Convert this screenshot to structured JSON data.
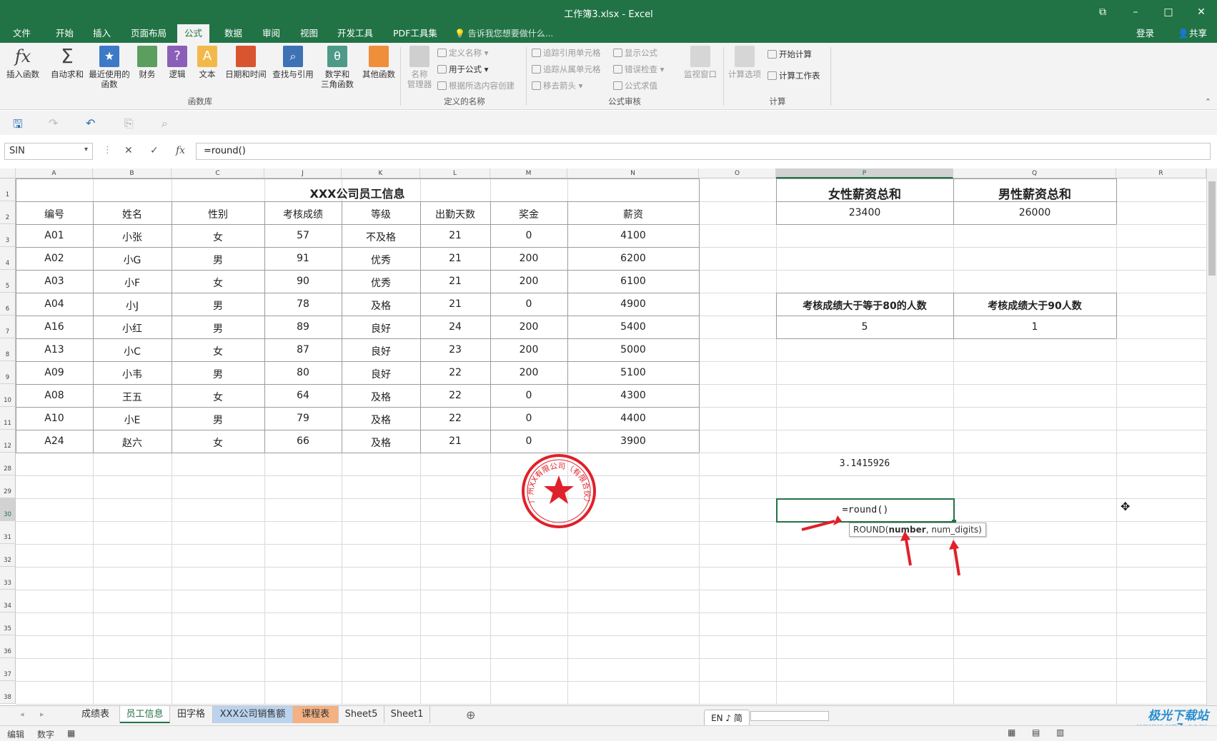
{
  "window": {
    "title": "工作簿3.xlsx - Excel"
  },
  "ribbon_tabs": [
    "文件",
    "开始",
    "插入",
    "页面布局",
    "公式",
    "数据",
    "审阅",
    "视图",
    "开发工具",
    "PDF工具集"
  ],
  "active_tab": "公式",
  "tell_me": "告诉我您想要做什么...",
  "account": {
    "login": "登录",
    "share": "共享"
  },
  "ribbon": {
    "insert_function": "插入函数",
    "autosum": "自动求和",
    "recent_line1": "最近使用的",
    "recent_line2": "函数",
    "financial": "财务",
    "logical": "逻辑",
    "text": "文本",
    "datetime": "日期和时间",
    "lookup": "查找与引用",
    "math_line1": "数学和",
    "math_line2": "三角函数",
    "other": "其他函数",
    "group_library": "函数库",
    "name_manager_line1": "名称",
    "name_manager_line2": "管理器",
    "define_name": "定义名称",
    "use_in_formula": "用于公式",
    "create_from_selection": "根据所选内容创建",
    "group_names": "定义的名称",
    "trace_precedents": "追踪引用单元格",
    "trace_dependents": "追踪从属单元格",
    "remove_arrows": "移去箭头",
    "show_formulas": "显示公式",
    "error_checking": "错误检查",
    "evaluate_formula": "公式求值",
    "watch_window": "监视窗口",
    "group_auditing": "公式审核",
    "calc_options": "计算选项",
    "calc_now": "开始计算",
    "calc_sheet": "计算工作表",
    "group_calc": "计算"
  },
  "formula_bar": {
    "name_box": "SIN",
    "formula": "=round()"
  },
  "columns": [
    "A",
    "B",
    "C",
    "J",
    "K",
    "L",
    "M",
    "N",
    "O",
    "P",
    "Q",
    "R"
  ],
  "rows": [
    "1",
    "2",
    "3",
    "4",
    "5",
    "6",
    "7",
    "8",
    "9",
    "10",
    "11",
    "12",
    "28",
    "29",
    "30",
    "31",
    "32",
    "33",
    "34",
    "35",
    "36",
    "37",
    "38"
  ],
  "table": {
    "title": "XXX公司员工信息",
    "headers": [
      "编号",
      "姓名",
      "性别",
      "考核成绩",
      "等级",
      "出勤天数",
      "奖金",
      "薪资"
    ],
    "rows": [
      [
        "A01",
        "小张",
        "女",
        "57",
        "不及格",
        "21",
        "0",
        "4100"
      ],
      [
        "A02",
        "小G",
        "男",
        "91",
        "优秀",
        "21",
        "200",
        "6200"
      ],
      [
        "A03",
        "小F",
        "女",
        "90",
        "优秀",
        "21",
        "200",
        "6100"
      ],
      [
        "A04",
        "小J",
        "男",
        "78",
        "及格",
        "21",
        "0",
        "4900"
      ],
      [
        "A16",
        "小红",
        "男",
        "89",
        "良好",
        "24",
        "200",
        "5400"
      ],
      [
        "A13",
        "小C",
        "女",
        "87",
        "良好",
        "23",
        "200",
        "5000"
      ],
      [
        "A09",
        "小韦",
        "男",
        "80",
        "良好",
        "22",
        "200",
        "5100"
      ],
      [
        "A08",
        "王五",
        "女",
        "64",
        "及格",
        "22",
        "0",
        "4300"
      ],
      [
        "A10",
        "小E",
        "男",
        "79",
        "及格",
        "22",
        "0",
        "4400"
      ],
      [
        "A24",
        "赵六",
        "女",
        "66",
        "及格",
        "21",
        "0",
        "3900"
      ]
    ]
  },
  "summary": {
    "female_total_label": "女性薪资总和",
    "male_total_label": "男性薪资总和",
    "female_total": "23400",
    "male_total": "26000",
    "score80_label": "考核成绩大于等于80的人数",
    "score90_label": "考核成绩大于90人数",
    "score80_count": "5",
    "score90_count": "1",
    "pi_value": "3.1415926",
    "editing_formula": "=round()"
  },
  "tooltip": {
    "fn": "ROUND(",
    "arg1": "number",
    "rest": ", num_digits)"
  },
  "stamp_text": "广州XX有限公司（有限合伙）",
  "sheets": [
    "成绩表",
    "员工信息",
    "田字格",
    "XXX公司销售额",
    "课程表",
    "Sheet5",
    "Sheet1"
  ],
  "active_sheet": "员工信息",
  "sheet_colors": {
    "XXX公司销售额": "#bcd3ee",
    "课程表": "#f4b183"
  },
  "status": {
    "mode": "编辑",
    "num": "数字"
  },
  "ime": "EN ♪ 简",
  "watermark": {
    "name": "极光下载站",
    "url": "www.xz7.com"
  },
  "colors": {
    "excel_green": "#217346",
    "arrow_red": "#e0202a"
  }
}
